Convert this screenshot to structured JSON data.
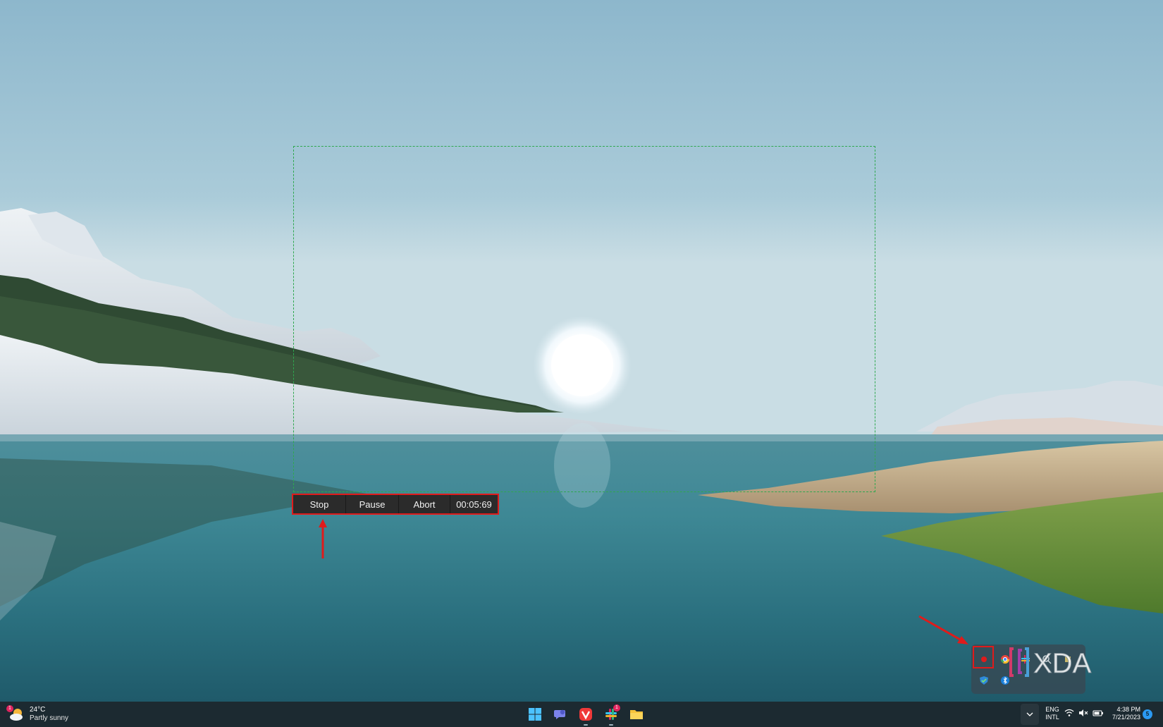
{
  "recording_toolbar": {
    "stop_label": "Stop",
    "pause_label": "Pause",
    "abort_label": "Abort",
    "timer": "00:05:69"
  },
  "watermark": {
    "text": "XDA"
  },
  "taskbar": {
    "weather": {
      "temperature": "24°C",
      "condition": "Partly sunny",
      "badge": "1"
    },
    "apps": [
      {
        "name": "Start",
        "icon": "windows-logo-icon"
      },
      {
        "name": "Teams Chat",
        "icon": "chat-icon"
      },
      {
        "name": "Vivaldi",
        "icon": "vivaldi-icon"
      },
      {
        "name": "Slack",
        "icon": "slack-icon",
        "badge": "1"
      },
      {
        "name": "File Explorer",
        "icon": "folder-icon"
      }
    ],
    "language": {
      "line1": "ENG",
      "line2": "INTL"
    },
    "clock": {
      "time": "4:38 PM",
      "date": "7/21/2023"
    },
    "notifications": "5"
  },
  "colors": {
    "toolbar_bg": "#2b2b2b",
    "annotation_red": "#e01b1b",
    "capture_border": "#2fa84f",
    "taskbar_bg": "#1c2a31"
  }
}
